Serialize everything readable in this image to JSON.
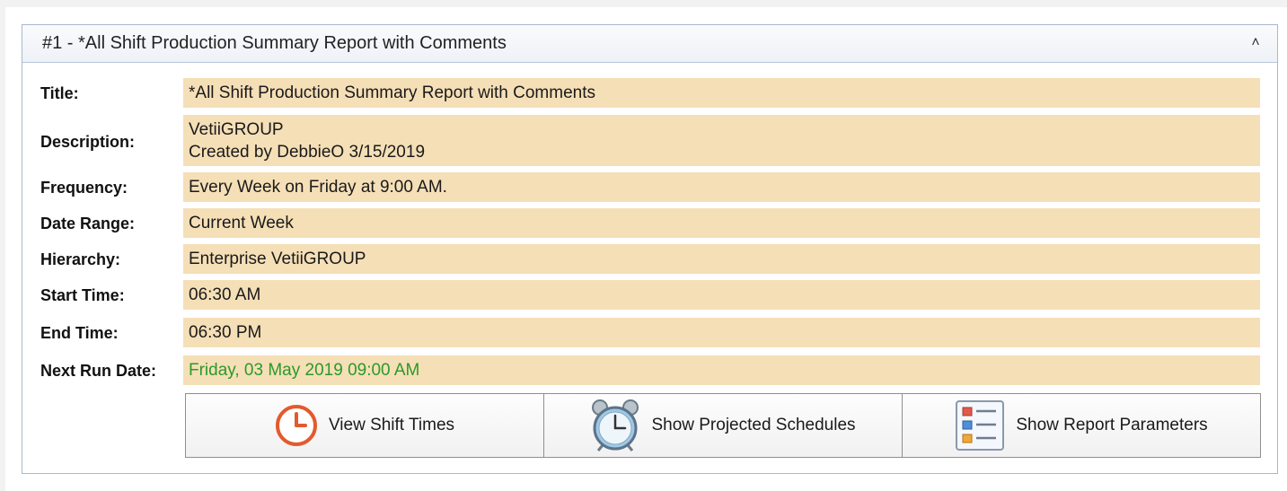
{
  "panel": {
    "header_title": "#1 - *All Shift Production Summary Report with Comments",
    "collapse_glyph": "˄"
  },
  "fields": {
    "title": {
      "label": "Title:",
      "value": "*All Shift Production Summary Report with Comments"
    },
    "description": {
      "label": "Description:",
      "line1": "VetiiGROUP",
      "line2": "Created by DebbieO 3/15/2019"
    },
    "frequency": {
      "label": "Frequency:",
      "value": "Every Week on Friday at 9:00 AM."
    },
    "date_range": {
      "label": "Date Range:",
      "value": "Current Week"
    },
    "hierarchy": {
      "label": "Hierarchy:",
      "value": "Enterprise VetiiGROUP"
    },
    "start_time": {
      "label": "Start Time:",
      "value": "06:30 AM"
    },
    "end_time": {
      "label": "End Time:",
      "value": "06:30 PM"
    },
    "next_run_date": {
      "label": "Next Run Date:",
      "value": "Friday, 03 May 2019 09:00 AM"
    }
  },
  "buttons": {
    "view_shift_times": {
      "label": "View Shift Times",
      "icon": "clock-icon"
    },
    "show_projected_schedules": {
      "label": "Show Projected Schedules",
      "icon": "alarm-clock-icon"
    },
    "show_report_parameters": {
      "label": "Show Report Parameters",
      "icon": "list-icon"
    }
  },
  "colors": {
    "value_background": "#f5dfb7",
    "next_run_text": "#2a9a2a",
    "panel_border": "#a9b8cc"
  }
}
